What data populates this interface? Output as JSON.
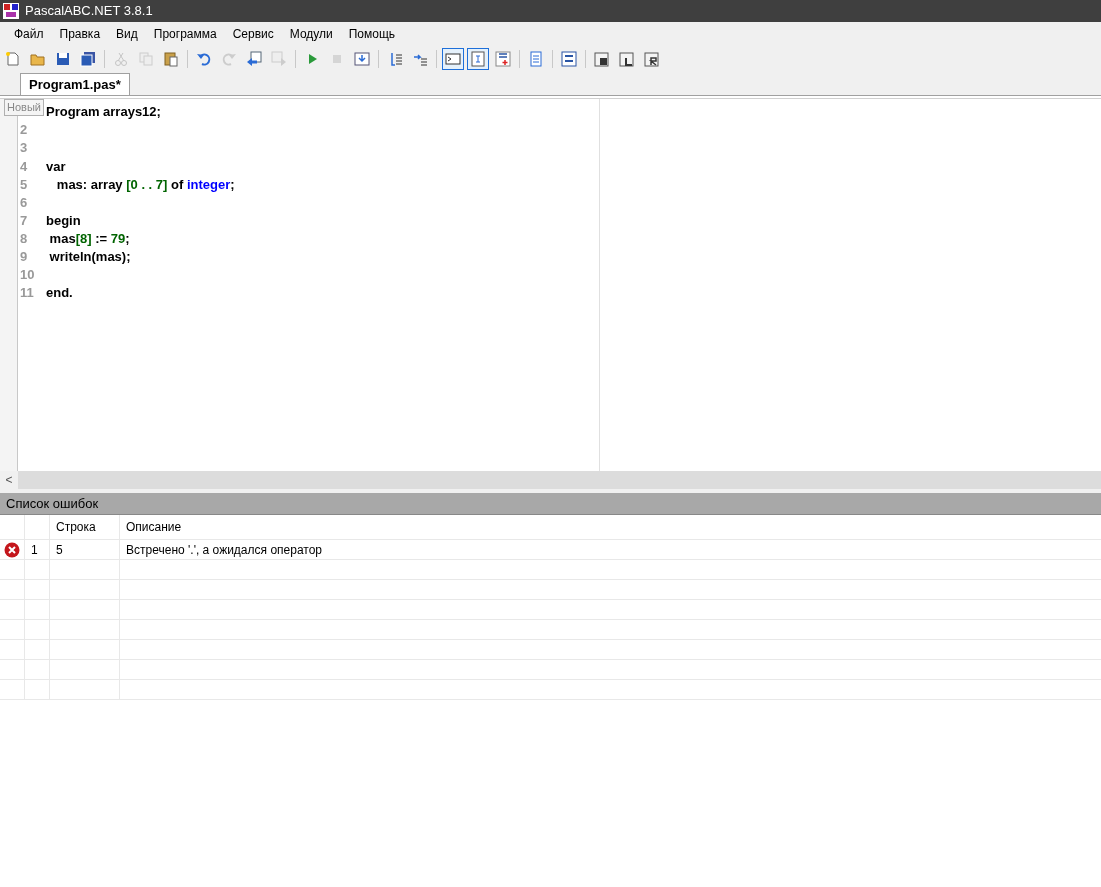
{
  "window": {
    "title": "PascalABC.NET 3.8.1"
  },
  "menu": [
    "Файл",
    "Правка",
    "Вид",
    "Программа",
    "Сервис",
    "Модули",
    "Помощь"
  ],
  "toolbar": [
    {
      "kind": "button",
      "disabled": false,
      "selected": false
    },
    {
      "kind": "button",
      "disabled": false,
      "selected": false
    },
    {
      "kind": "button",
      "disabled": false,
      "selected": false
    },
    {
      "kind": "button",
      "disabled": false,
      "selected": false
    },
    {
      "kind": "separator"
    },
    {
      "kind": "button",
      "disabled": true,
      "selected": false
    },
    {
      "kind": "button",
      "disabled": true,
      "selected": false
    },
    {
      "kind": "button",
      "disabled": false,
      "selected": false
    },
    {
      "kind": "separator"
    },
    {
      "kind": "button",
      "disabled": false,
      "selected": false
    },
    {
      "kind": "button",
      "disabled": true,
      "selected": false
    },
    {
      "kind": "button",
      "disabled": false,
      "selected": false
    },
    {
      "kind": "button",
      "disabled": true,
      "selected": false
    },
    {
      "kind": "separator"
    },
    {
      "kind": "button",
      "disabled": false,
      "selected": false
    },
    {
      "kind": "button",
      "disabled": true,
      "selected": false
    },
    {
      "kind": "button",
      "disabled": false,
      "selected": false
    },
    {
      "kind": "separator"
    },
    {
      "kind": "button",
      "disabled": false,
      "selected": false
    },
    {
      "kind": "button",
      "disabled": false,
      "selected": false
    },
    {
      "kind": "separator"
    },
    {
      "kind": "button",
      "disabled": false,
      "selected": true
    },
    {
      "kind": "button",
      "disabled": false,
      "selected": true
    },
    {
      "kind": "button",
      "disabled": false,
      "selected": false
    },
    {
      "kind": "separator"
    },
    {
      "kind": "button",
      "disabled": false,
      "selected": false
    },
    {
      "kind": "separator"
    },
    {
      "kind": "button",
      "disabled": false,
      "selected": false
    },
    {
      "kind": "separator"
    },
    {
      "kind": "button",
      "disabled": false,
      "selected": false
    },
    {
      "kind": "button",
      "disabled": false,
      "selected": false
    },
    {
      "kind": "button",
      "disabled": false,
      "selected": false
    }
  ],
  "tabs": [
    {
      "label": "Program1.pas*",
      "selected": true
    }
  ],
  "tooltip": "Новый",
  "editor": {
    "lines": [
      {
        "tokens": [
          {
            "kind": "plain",
            "text": "Program arrays12;"
          }
        ]
      },
      {
        "number": "2"
      },
      {
        "number": "3"
      },
      {
        "number": "4",
        "tokens": [
          {
            "kind": "plain",
            "text": "var"
          }
        ]
      },
      {
        "number": "5",
        "tokens": [
          {
            "kind": "plain",
            "text": "   mas: array "
          },
          {
            "kind": "number",
            "text": "[0 . . 7]"
          },
          {
            "kind": "plain",
            "text": " of "
          },
          {
            "kind": "type",
            "text": "integer"
          },
          {
            "kind": "plain",
            "text": ";"
          }
        ]
      },
      {
        "number": "6"
      },
      {
        "number": "7",
        "tokens": [
          {
            "kind": "plain",
            "text": "begin"
          }
        ]
      },
      {
        "number": "8",
        "tokens": [
          {
            "kind": "plain",
            "text": " mas"
          },
          {
            "kind": "number",
            "text": "[8]"
          },
          {
            "kind": "plain",
            "text": " := "
          },
          {
            "kind": "number",
            "text": "79"
          },
          {
            "kind": "plain",
            "text": ";"
          }
        ]
      },
      {
        "number": "9",
        "tokens": [
          {
            "kind": "plain",
            "text": " writeln(mas);"
          }
        ]
      },
      {
        "number": "10"
      },
      {
        "number": "11",
        "tokens": [
          {
            "kind": "plain",
            "text": "end."
          }
        ]
      }
    ]
  },
  "scrollbar": {
    "arrow": "<"
  },
  "errors": {
    "title": "Список ошибок",
    "columns": [
      "Строка",
      "Описание"
    ],
    "rows": [
      {
        "kind": "error",
        "index": "1",
        "line": "5",
        "description": "Встречено '.', а ожидался оператор"
      }
    ]
  }
}
